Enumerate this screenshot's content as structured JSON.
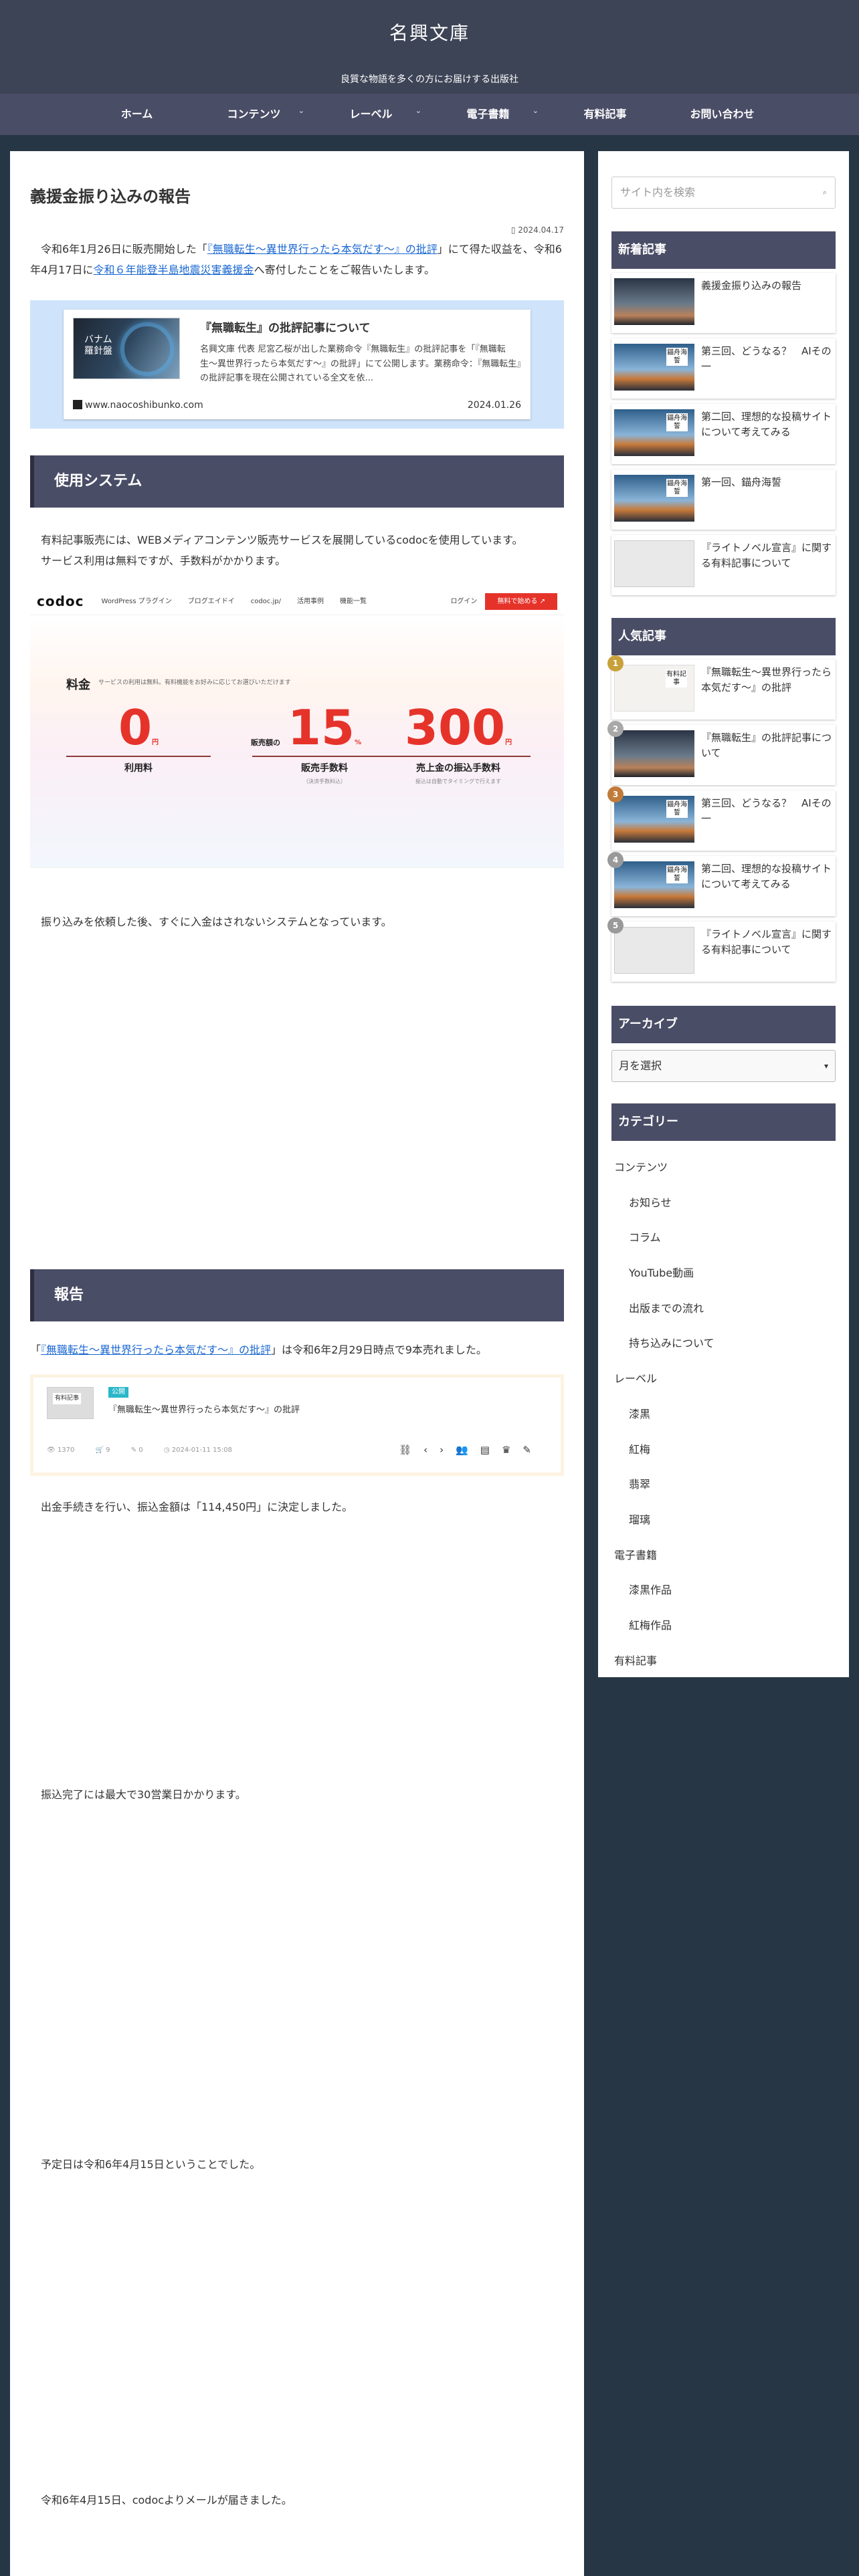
{
  "site": {
    "title": "名興文庫",
    "tagline": "良質な物語を多くの方にお届けする出版社"
  },
  "nav": [
    {
      "label": "ホーム",
      "has_sub": false
    },
    {
      "label": "コンテンツ",
      "has_sub": true
    },
    {
      "label": "レーベル",
      "has_sub": true
    },
    {
      "label": "電子書籍",
      "has_sub": true
    },
    {
      "label": "有料記事",
      "has_sub": false
    },
    {
      "label": "お問い合わせ",
      "has_sub": false
    }
  ],
  "article": {
    "title": "義援金振り込みの報告",
    "date": "2024.04.17",
    "intro_1": "令和6年1月26日に販売開始した「",
    "intro_link_1": "『無職転生〜異世界行ったら本気だす〜』の批評",
    "intro_2": "」にて得た収益を、令和6年4月17日に",
    "intro_link_2": "令和６年能登半島地震災害義援金",
    "intro_3": "へ寄付したことをご報告いたします。",
    "blogcard": {
      "thumb_text": "バナム\n羅針盤",
      "title": "『無職転生』の批評記事について",
      "excerpt": "名興文庫 代表 尼宮乙桜が出した業務命令『無職転生』の批評記事を「『無職転生〜異世界行ったら本気だす〜』の批評」にて公開します。業務命令：『無職転生』の批評記事を現在公開されている全文を依...",
      "domain": "www.naocoshibunko.com",
      "date": "2024.01.26"
    },
    "h2_system": "使用システム",
    "system_p1": "有料記事販売には、WEBメディアコンテンツ販売サービスを展開しているcodocを使用しています。",
    "system_p2": "サービス利用は無料ですが、手数料がかかります。",
    "codoc": {
      "logo": "codoc",
      "nav": [
        "WordPress プラグイン",
        "ブログエイドイ",
        "codoc.jp/",
        "活用事例",
        "機能一覧"
      ],
      "login": "ログイン",
      "cta": "無料で始める ↗",
      "price_label": "料金",
      "price_sub": "サービスの利用は無料。有料機能をお好みに応じてお選びいただけます",
      "cols": [
        {
          "num": "0",
          "unit": "円",
          "cap": "利用料",
          "note": "",
          "pre": ""
        },
        {
          "num": "15",
          "unit": "%",
          "cap": "販売手数料",
          "note": "（決済手数料込）",
          "pre": "販売額の"
        },
        {
          "num": "300",
          "unit": "円",
          "cap": "売上金の振込手数料",
          "note": "振込は自動でタイミングで行えます",
          "pre": ""
        }
      ]
    },
    "system_p3": "振り込みを依頼した後、すぐに入金はされないシステムとなっています。",
    "h2_report": "報告",
    "report_pre": "「",
    "report_link": "『無職転生〜異世界行ったら本気だす〜』の批評",
    "report_post": "」は令和6年2月29日時点で9本売れました。",
    "report_card": {
      "thumb_label": "有料記事",
      "badge": "公開",
      "title": "『無職転生〜異世界行ったら本気だす〜』の批評",
      "meta": [
        "1370",
        "9",
        "0",
        "2024-01-11 15:08"
      ]
    },
    "report_p1": "出金手続きを行い、振込金額は「114,450円」に決定しました。",
    "report_p2": "振込完了には最大で30営業日かかります。",
    "report_p3": "予定日は令和6年4月15日ということでした。",
    "report_p4": "令和6年4月15日、codocよりメールが届きました。"
  },
  "sidebar": {
    "search_placeholder": "サイト内を検索",
    "new_title": "新着記事",
    "new_posts": [
      {
        "title": "義援金振り込みの報告",
        "thumb": "night",
        "label": ""
      },
      {
        "title": "第三回、どうなる？　AIその一",
        "thumb": "ship",
        "label": "錨舟海誓"
      },
      {
        "title": "第二回、理想的な投稿サイトについて考えてみる",
        "thumb": "ship",
        "label": "錨舟海誓"
      },
      {
        "title": "第一回、錨舟海誓",
        "thumb": "ship",
        "label": "錨舟海誓"
      },
      {
        "title": "『ライトノベル宣言』に関する有料記事について",
        "thumb": "book",
        "label": ""
      }
    ],
    "popular_title": "人気記事",
    "popular_posts": [
      {
        "rank": "1",
        "title": "『無職転生〜異世界行ったら本気だす〜』の批評",
        "thumb": "paper",
        "label": "有料記事"
      },
      {
        "rank": "2",
        "title": "『無職転生』の批評記事について",
        "thumb": "night",
        "label": ""
      },
      {
        "rank": "3",
        "title": "第三回、どうなる？　AIその一",
        "thumb": "ship",
        "label": "錨舟海誓"
      },
      {
        "rank": "4",
        "title": "第二回、理想的な投稿サイトについて考えてみる",
        "thumb": "ship",
        "label": "錨舟海誓"
      },
      {
        "rank": "5",
        "title": "『ライトノベル宣言』に関する有料記事について",
        "thumb": "book",
        "label": ""
      }
    ],
    "rank_colors": [
      "#c9a13b",
      "#a8a8a8",
      "#c07a3a",
      "#999999",
      "#999999"
    ],
    "archive_title": "アーカイブ",
    "archive_select": "月を選択",
    "category_title": "カテゴリー",
    "categories": [
      {
        "label": "コンテンツ",
        "child": false
      },
      {
        "label": "お知らせ",
        "child": true
      },
      {
        "label": "コラム",
        "child": true
      },
      {
        "label": "YouTube動画",
        "child": true
      },
      {
        "label": "出版までの流れ",
        "child": true
      },
      {
        "label": "持ち込みについて",
        "child": true
      },
      {
        "label": "レーベル",
        "child": false
      },
      {
        "label": "漆黒",
        "child": true
      },
      {
        "label": "紅梅",
        "child": true
      },
      {
        "label": "翡翠",
        "child": true
      },
      {
        "label": "瑠璃",
        "child": true
      },
      {
        "label": "電子書籍",
        "child": false
      },
      {
        "label": "漆黒作品",
        "child": true
      },
      {
        "label": "紅梅作品",
        "child": true
      },
      {
        "label": "有料記事",
        "child": false
      }
    ]
  }
}
